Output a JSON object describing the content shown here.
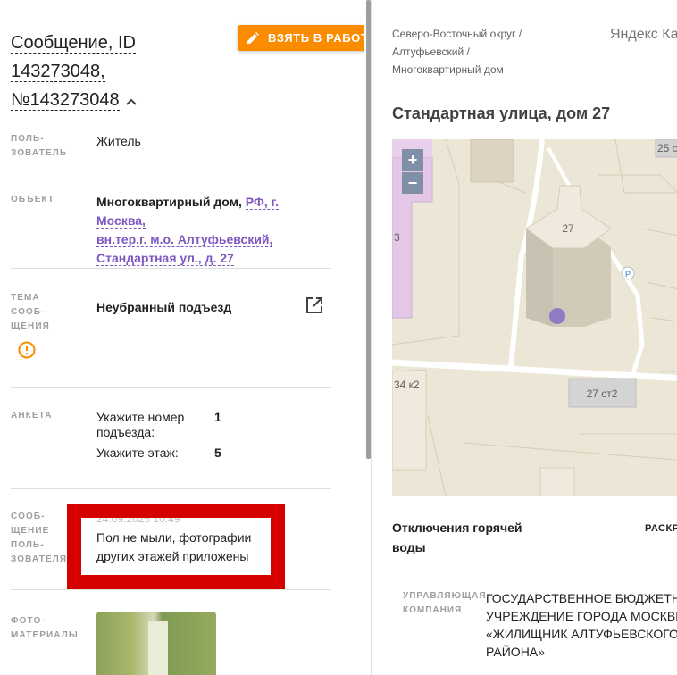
{
  "header": {
    "title_line1": "Сообщение, ID",
    "title_line2": "143273048,",
    "title_line3": "№143273048",
    "take_button_label": "ВЗЯТЬ В РАБОТУ"
  },
  "fields": {
    "user": {
      "label": "ПОЛЬ-\nЗОВАТЕЛЬ",
      "value": "Житель"
    },
    "object": {
      "label": "ОБЪЕКТ",
      "type": "Многоквартирный дом,",
      "link_line1": "РФ, г. Москва,",
      "link_line2": "вн.тер.г. м.о. Алтуфьевский,",
      "link_line3": "Стандартная ул., д. 27"
    },
    "topic": {
      "label": "ТЕМА\nСООБ-\nЩЕНИЯ",
      "value": "Неубранный подъезд"
    },
    "form": {
      "label": "АНКЕТА",
      "q1_label": "Укажите номер подъезда:",
      "q1_value": "1",
      "q2_label": "Укажите этаж:",
      "q2_value": "5"
    },
    "message": {
      "label": "СООБ-\nЩЕНИЕ\nПОЛЬ-\nЗОВАТЕЛЯ",
      "date": "24.09.2025 10:49",
      "text": "Пол не мыли, фотографии других этажей приложены"
    },
    "photos": {
      "label": "ФОТО-\nМАТЕРИАЛЫ"
    }
  },
  "right": {
    "breadcrumb_1": "Северо-Восточный округ /",
    "breadcrumb_2": "Алтуфьевский /",
    "breadcrumb_3": "Многоквартирный дом",
    "map_provider": "Яндекс Карты",
    "address": "Стандартная улица, дом 27",
    "map": {
      "zoom_in": "+",
      "zoom_out": "−",
      "label_27": "27",
      "label_25": "25 с",
      "label_34k2": "34 к2",
      "label_27st2": "27 ст2",
      "label_3": "3",
      "label_p": "P"
    },
    "hot_water": "Отключения горячей воды",
    "expand_label": "РАСКРЫТЬ",
    "mgmt_label": "УПРАВЛЯЮЩАЯ КОМПАНИЯ",
    "mgmt_line1": "ГОСУДАРСТВЕННОЕ БЮДЖЕТНОЕ",
    "mgmt_line2": "УЧРЕЖДЕНИЕ ГОРОДА МОСКВЫ",
    "mgmt_line3": "«ЖИЛИЩНИК АЛТУФЬЕВСКОГО",
    "mgmt_line4": "РАЙОНА»"
  },
  "colors": {
    "accent_orange": "#fb8c00",
    "link_purple": "#7e57c2",
    "highlight_red": "#d50000",
    "map_marker": "#8e7cc3"
  }
}
